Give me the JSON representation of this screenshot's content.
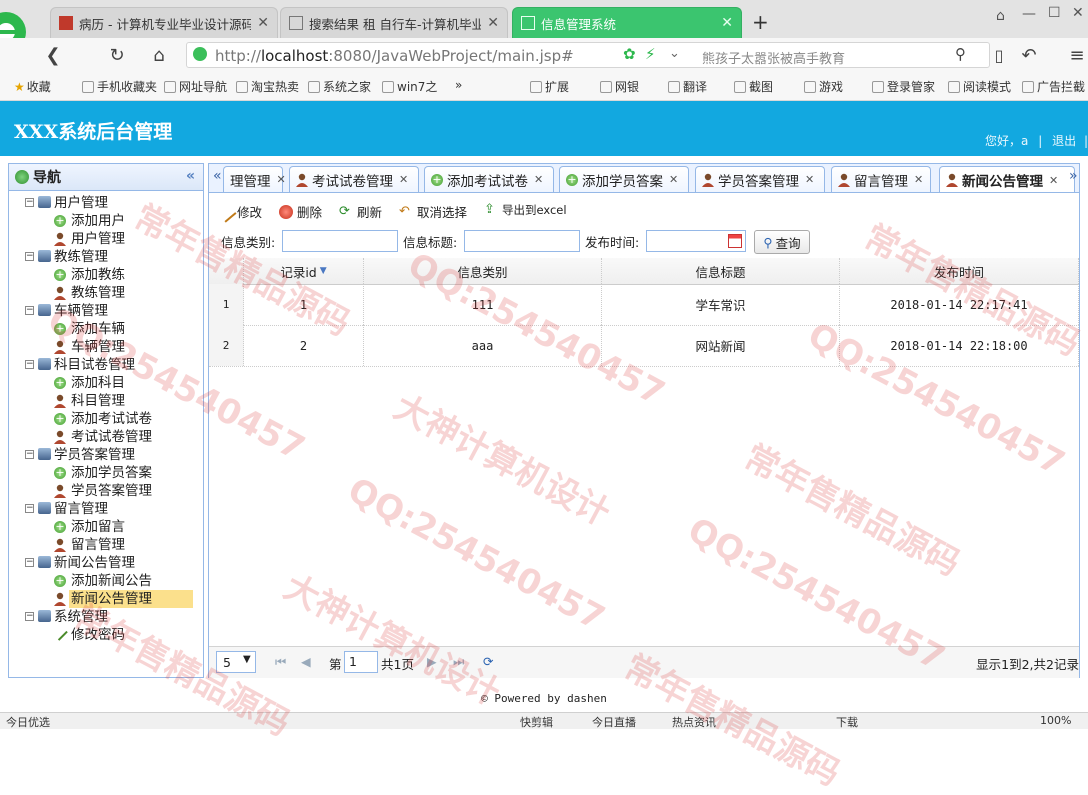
{
  "browser": {
    "tabs": [
      {
        "title": "病历 - 计算机专业毕业设计源码"
      },
      {
        "title": "搜索结果 租 自行车-计算机毕业"
      },
      {
        "title": "信息管理系统"
      }
    ],
    "new_tab": "+",
    "url_prefix": "http://",
    "url_host": "localhost",
    "url_rest": ":8080/JavaWebProject/main.jsp#",
    "search_hint": "熊孩子太嚣张被高手教育",
    "bookmarks": [
      "收藏",
      "手机收藏夹",
      "网址导航",
      "淘宝热卖",
      "系统之家",
      "win7之",
      "»",
      "扩展",
      "网银",
      "翻译",
      "截图",
      "游戏",
      "登录管家",
      "阅读模式",
      "广告拦截"
    ]
  },
  "app": {
    "title": "XXX系统后台管理",
    "greeting": "您好，a",
    "logout": "退出"
  },
  "nav": {
    "title": "导航",
    "collapse": "«",
    "groups": [
      {
        "label": "用户管理",
        "items": [
          {
            "label": "添加用户",
            "type": "add"
          },
          {
            "label": "用户管理",
            "type": "user"
          }
        ]
      },
      {
        "label": "教练管理",
        "items": [
          {
            "label": "添加教练",
            "type": "add"
          },
          {
            "label": "教练管理",
            "type": "user"
          }
        ]
      },
      {
        "label": "车辆管理",
        "items": [
          {
            "label": "添加车辆",
            "type": "add"
          },
          {
            "label": "车辆管理",
            "type": "user"
          }
        ]
      },
      {
        "label": "科目试卷管理",
        "items": [
          {
            "label": "添加科目",
            "type": "add"
          },
          {
            "label": "科目管理",
            "type": "user"
          },
          {
            "label": "添加考试试卷",
            "type": "add"
          },
          {
            "label": "考试试卷管理",
            "type": "user"
          }
        ]
      },
      {
        "label": "学员答案管理",
        "items": [
          {
            "label": "添加学员答案",
            "type": "add"
          },
          {
            "label": "学员答案管理",
            "type": "user"
          }
        ]
      },
      {
        "label": "留言管理",
        "items": [
          {
            "label": "添加留言",
            "type": "add"
          },
          {
            "label": "留言管理",
            "type": "user"
          }
        ]
      },
      {
        "label": "新闻公告管理",
        "items": [
          {
            "label": "添加新闻公告",
            "type": "add"
          },
          {
            "label": "新闻公告管理",
            "type": "user",
            "selected": true
          }
        ]
      },
      {
        "label": "系统管理",
        "items": [
          {
            "label": "修改密码",
            "type": "pencil"
          }
        ]
      }
    ]
  },
  "content_tabs": [
    {
      "label": "理管理",
      "icon": "none"
    },
    {
      "label": "考试试卷管理",
      "icon": "user"
    },
    {
      "label": "添加考试试卷",
      "icon": "add"
    },
    {
      "label": "添加学员答案",
      "icon": "add"
    },
    {
      "label": "学员答案管理",
      "icon": "user"
    },
    {
      "label": "留言管理",
      "icon": "user"
    },
    {
      "label": "新闻公告管理",
      "icon": "user",
      "active": true
    }
  ],
  "actions": [
    "修改",
    "删除",
    "刷新",
    "取消选择",
    "导出到excel"
  ],
  "search": {
    "type_label": "信息类别:",
    "title_label": "信息标题:",
    "time_label": "发布时间:",
    "query": "查询"
  },
  "grid": {
    "columns": [
      "记录id",
      "信息类别",
      "信息标题",
      "发布时间"
    ],
    "rows": [
      {
        "n": "1",
        "id": "1",
        "type": "111",
        "title": "学车常识",
        "time": "2018-01-14 22:17:41"
      },
      {
        "n": "2",
        "id": "2",
        "type": "aaa",
        "title": "网站新闻",
        "time": "2018-01-14 22:18:00"
      }
    ]
  },
  "pager": {
    "page_size": "5",
    "page_prefix": "第",
    "page_value": "1",
    "page_suffix": "共1页",
    "summary": "显示1到2,共2记录"
  },
  "footer": "© Powered by dashen",
  "statusbar": [
    "今日优选",
    "快剪辑",
    "今日直播",
    "热点资讯",
    "下载",
    "100%"
  ],
  "watermarks": [
    "常年售精品源码",
    "QQ:254540457",
    "大神计算机设计"
  ],
  "colors": {
    "header": "#12a8e0",
    "active_browser_tab": "#3bc56f",
    "panel_border": "#95b8e7",
    "selected_nav": "#fbe08c"
  }
}
